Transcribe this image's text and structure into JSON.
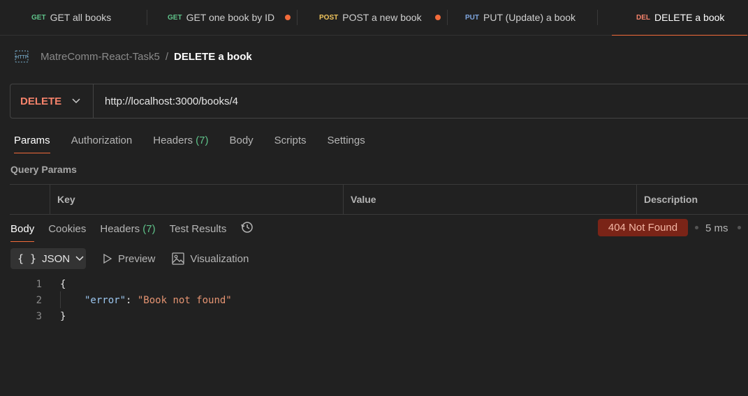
{
  "tabs": [
    {
      "method": "GET",
      "label": "GET all books",
      "color": "#5fc38a"
    },
    {
      "method": "GET",
      "label": "GET one book by ID",
      "color": "#5fc38a"
    },
    {
      "method": "POST",
      "label": "POST a new book",
      "color": "#f0c45c"
    },
    {
      "method": "PUT",
      "label": "PUT (Update) a book",
      "color": "#7fa7e0"
    },
    {
      "method": "DEL",
      "label": "DELETE a book",
      "color": "#f6836b"
    }
  ],
  "breadcrumb": {
    "icon": "HTTP",
    "project": "MatreComm-React-Task5",
    "separator": "/",
    "request": "DELETE a book"
  },
  "request": {
    "method": "DELETE",
    "url": "http://localhost:3000/books/4"
  },
  "request_tabs": {
    "params": "Params",
    "authorization": "Authorization",
    "headers": "Headers",
    "headers_count": "(7)",
    "body": "Body",
    "scripts": "Scripts",
    "settings": "Settings"
  },
  "query_params": {
    "title": "Query Params",
    "key": "Key",
    "value": "Value",
    "description": "Description"
  },
  "response_tabs": {
    "body": "Body",
    "cookies": "Cookies",
    "headers": "Headers",
    "headers_count": "(7)",
    "test_results": "Test Results"
  },
  "response": {
    "status": "404 Not Found",
    "time": "5 ms"
  },
  "toolbar": {
    "format": "JSON",
    "braces": "{ }",
    "preview": "Preview",
    "visualization": "Visualization"
  },
  "code": {
    "lines": [
      "1",
      "2",
      "3"
    ],
    "open": "{",
    "key": "\"error\"",
    "colon": ": ",
    "value": "\"Book not found\"",
    "close": "}"
  }
}
